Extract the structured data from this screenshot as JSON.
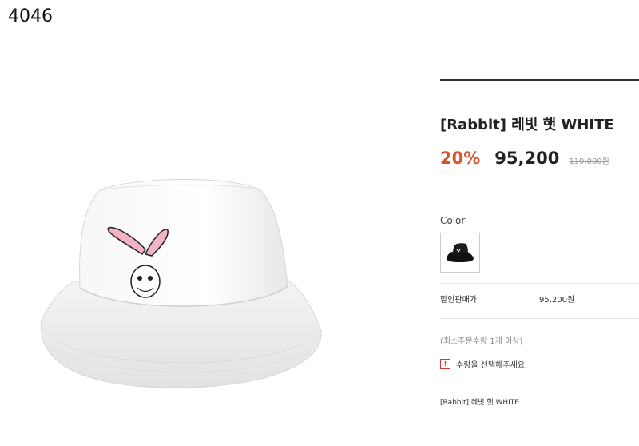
{
  "page": {
    "id_label": "4046"
  },
  "product": {
    "title": "[Rabbit] 레빗 햇 WHITE",
    "discount": "20%",
    "price": "95,200",
    "original_price": "119,000원",
    "image_icon": "white-bucket-hat-with-rabbit-print"
  },
  "options": {
    "color_label": "Color",
    "swatch_icon": "black-bucket-hat-thumbnail"
  },
  "summary": {
    "sale_price_label": "할인판매가",
    "sale_price_value": "95,200원",
    "min_order": "(최소주문수량 1개 이상)",
    "warning_icon": "!",
    "warning_text": "수량을 선택해주세요.",
    "selected_item": "[Rabbit] 레빗 햇 WHITE"
  },
  "colors": {
    "accent": "#d3572f",
    "warning": "#dd3333"
  }
}
